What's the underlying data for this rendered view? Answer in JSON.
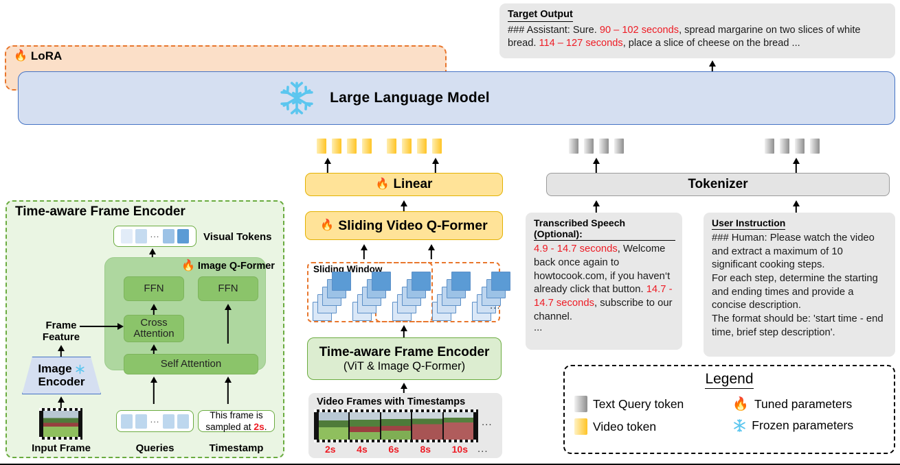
{
  "target_output": {
    "title": "Target Output",
    "prefix": "### Assistant: Sure. ",
    "time1": "90 – 102 seconds",
    "mid": ", spread margarine on two slices of white bread. ",
    "time2": "114 – 127 seconds",
    "suffix": ",  place a slice of cheese on the bread ..."
  },
  "lora": {
    "label": "LoRA",
    "icon": "fire-icon",
    "border_color": "#e8762c",
    "fill": "#fbdfc8"
  },
  "llm": {
    "title": "Large Language Model",
    "icon": "snowflake-icon",
    "border_color": "#4472c4",
    "fill": "#d5dff1"
  },
  "linear": {
    "label": "Linear",
    "icon": "fire-icon"
  },
  "sliding_qformer": {
    "label": "Sliding Video Q-Former",
    "icon": "fire-icon"
  },
  "tokenizer": {
    "label": "Tokenizer"
  },
  "tafe_mid": {
    "title": "Time-aware Frame Encoder",
    "subtitle": "(ViT & Image Q-Former)"
  },
  "sliding_window": {
    "label": "Sliding Window",
    "ellipsis": "..."
  },
  "video_frames": {
    "title": "Video Frames with Timestamps",
    "timestamps": [
      "2s",
      "4s",
      "6s",
      "8s",
      "10s"
    ],
    "ellipsis": "...",
    "frame_ellipsis": "..."
  },
  "tafe_detail": {
    "title": "Time-aware Frame Encoder",
    "visual_tokens_label": "Visual Tokens",
    "qformer_label": "Image Q-Former",
    "qformer_icon": "fire-icon",
    "ffn_left": "FFN",
    "ffn_right": "FFN",
    "cross_attention": "Cross Attention",
    "self_attention": "Self Attention",
    "frame_feature": "Frame Feature",
    "image_encoder": "Image Encoder",
    "image_encoder_icon": "snowflake-icon",
    "input_frame": "Input Frame",
    "queries": "Queries",
    "timestamp_label": "Timestamp",
    "timestamp_text_a": "This frame is",
    "timestamp_text_b": "sampled at ",
    "timestamp_value": "2s",
    "timestamp_period": ".",
    "token_ellipsis": "..."
  },
  "transcribed_speech": {
    "title": "Transcribed Speech (Optional):",
    "t1": "4.9 - 14.7 seconds",
    "b1": ", Welcome back once again to howtocook.com, if you haven‘t already click that button.",
    "t2": "14.7 - 14.7 seconds",
    "b2": ", subscribe to our channel.",
    "trailing": "..."
  },
  "user_instruction": {
    "title": "User Instruction",
    "body": "### Human: Please watch the video and extract a maximum of 10 significant cooking steps.\nFor each step, determine the starting and ending times and provide a concise description.\nThe format should be: 'start time - end time, brief step description'."
  },
  "legend": {
    "title": "Legend",
    "items": [
      {
        "swatch": "text-query-token-swatch",
        "label": "Text Query token"
      },
      {
        "swatch": "fire-icon",
        "label": "Tuned parameters"
      },
      {
        "swatch": "video-token-swatch",
        "label": "Video token"
      },
      {
        "swatch": "snowflake-icon",
        "label": "Frozen parameters"
      }
    ]
  },
  "colors": {
    "accent_red": "#ee1b24",
    "video_token": "#ffc425",
    "text_token": "#8e8e8e",
    "green": "#6aab3f",
    "blue": "#4472c4",
    "orange": "#e8762c"
  }
}
